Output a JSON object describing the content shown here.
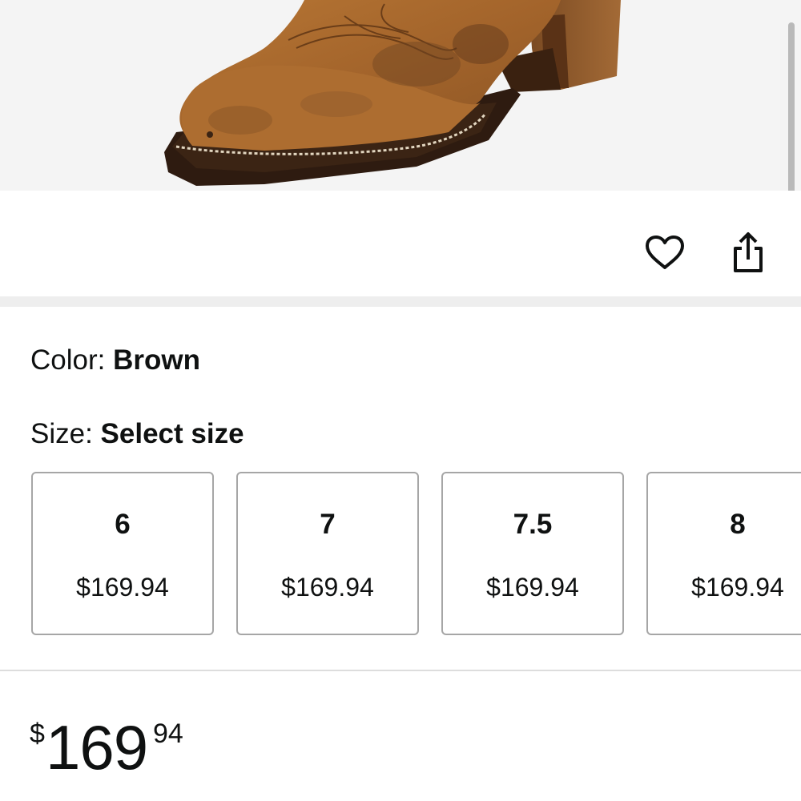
{
  "product": {
    "image_alt": "Brown leather western boot"
  },
  "actions": {
    "wishlist_icon": "heart-icon",
    "share_icon": "share-icon"
  },
  "variations": {
    "color_key": "Color: ",
    "color_value": "Brown",
    "size_key": "Size: ",
    "size_value": "Select size",
    "sizes": [
      {
        "size": "6",
        "price": "$169.94"
      },
      {
        "size": "7",
        "price": "$169.94"
      },
      {
        "size": "7.5",
        "price": "$169.94"
      },
      {
        "size": "8",
        "price": "$169.94"
      }
    ]
  },
  "price": {
    "symbol": "$",
    "whole": "169",
    "fraction": "94"
  },
  "colors": {
    "text": "#0f1111",
    "tile_border": "#a6a6a6",
    "image_bg": "#f4f4f4",
    "leather": "#a8692f"
  }
}
